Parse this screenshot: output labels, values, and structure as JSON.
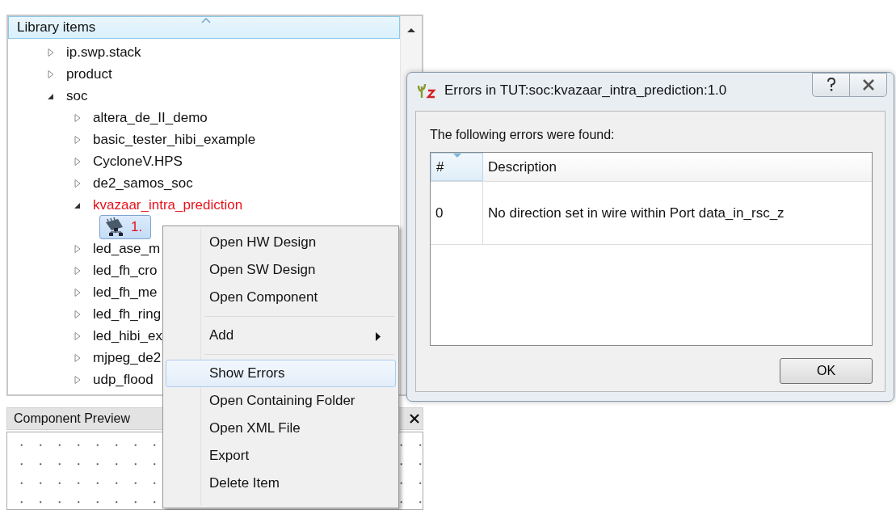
{
  "library": {
    "title": "Library items",
    "items": [
      {
        "label": "ip.swp.stack",
        "expanded": false,
        "error": false,
        "selected": false
      },
      {
        "label": "product",
        "expanded": false,
        "error": false,
        "selected": false
      },
      {
        "label": "soc",
        "expanded": true,
        "error": false,
        "selected": false,
        "children": [
          {
            "label": "altera_de_II_demo",
            "expanded": false,
            "error": false,
            "selected": false
          },
          {
            "label": "basic_tester_hibi_example",
            "expanded": false,
            "error": false,
            "selected": false
          },
          {
            "label": "CycloneV.HPS",
            "expanded": false,
            "error": false,
            "selected": false
          },
          {
            "label": "de2_samos_soc",
            "expanded": false,
            "error": false,
            "selected": false
          },
          {
            "label": "kvazaar_intra_prediction",
            "expanded": true,
            "error": true,
            "selected": false,
            "children": [
              {
                "label": "1.",
                "kind": "version",
                "error": true,
                "selected": true
              }
            ]
          },
          {
            "label": "led_ase_m",
            "expanded": false,
            "error": false,
            "selected": false
          },
          {
            "label": "led_fh_cro",
            "expanded": false,
            "error": false,
            "selected": false
          },
          {
            "label": "led_fh_me",
            "expanded": false,
            "error": false,
            "selected": false
          },
          {
            "label": "led_fh_ring",
            "expanded": false,
            "error": false,
            "selected": false
          },
          {
            "label": "led_hibi_ex",
            "expanded": false,
            "error": false,
            "selected": false
          },
          {
            "label": "mjpeg_de2",
            "expanded": false,
            "error": false,
            "selected": false
          },
          {
            "label": "udp_flood",
            "expanded": false,
            "error": false,
            "selected": false
          }
        ]
      }
    ]
  },
  "preview": {
    "title": "Component Preview"
  },
  "context_menu": {
    "items": [
      {
        "kind": "item",
        "label": "Open HW Design",
        "selected": false
      },
      {
        "kind": "item",
        "label": "Open SW Design",
        "selected": false
      },
      {
        "kind": "item",
        "label": "Open Component",
        "selected": false
      },
      {
        "kind": "separator"
      },
      {
        "kind": "submenu",
        "label": "Add",
        "selected": false
      },
      {
        "kind": "separator"
      },
      {
        "kind": "item",
        "label": "Show Errors",
        "selected": true
      },
      {
        "kind": "item",
        "label": "Open Containing Folder",
        "selected": false
      },
      {
        "kind": "item",
        "label": "Open XML File",
        "selected": false
      },
      {
        "kind": "item",
        "label": "Export",
        "selected": false
      },
      {
        "kind": "item",
        "label": "Delete Item",
        "selected": false
      }
    ]
  },
  "dialog": {
    "title": "Errors in TUT:soc:kvazaar_intra_prediction:1.0",
    "message": "The following errors were found:",
    "table": {
      "columns": [
        "#",
        "Description"
      ],
      "rows": [
        [
          "0",
          "No direction set in wire within Port data_in_rsc_z"
        ]
      ]
    },
    "buttons": [
      "OK"
    ]
  }
}
